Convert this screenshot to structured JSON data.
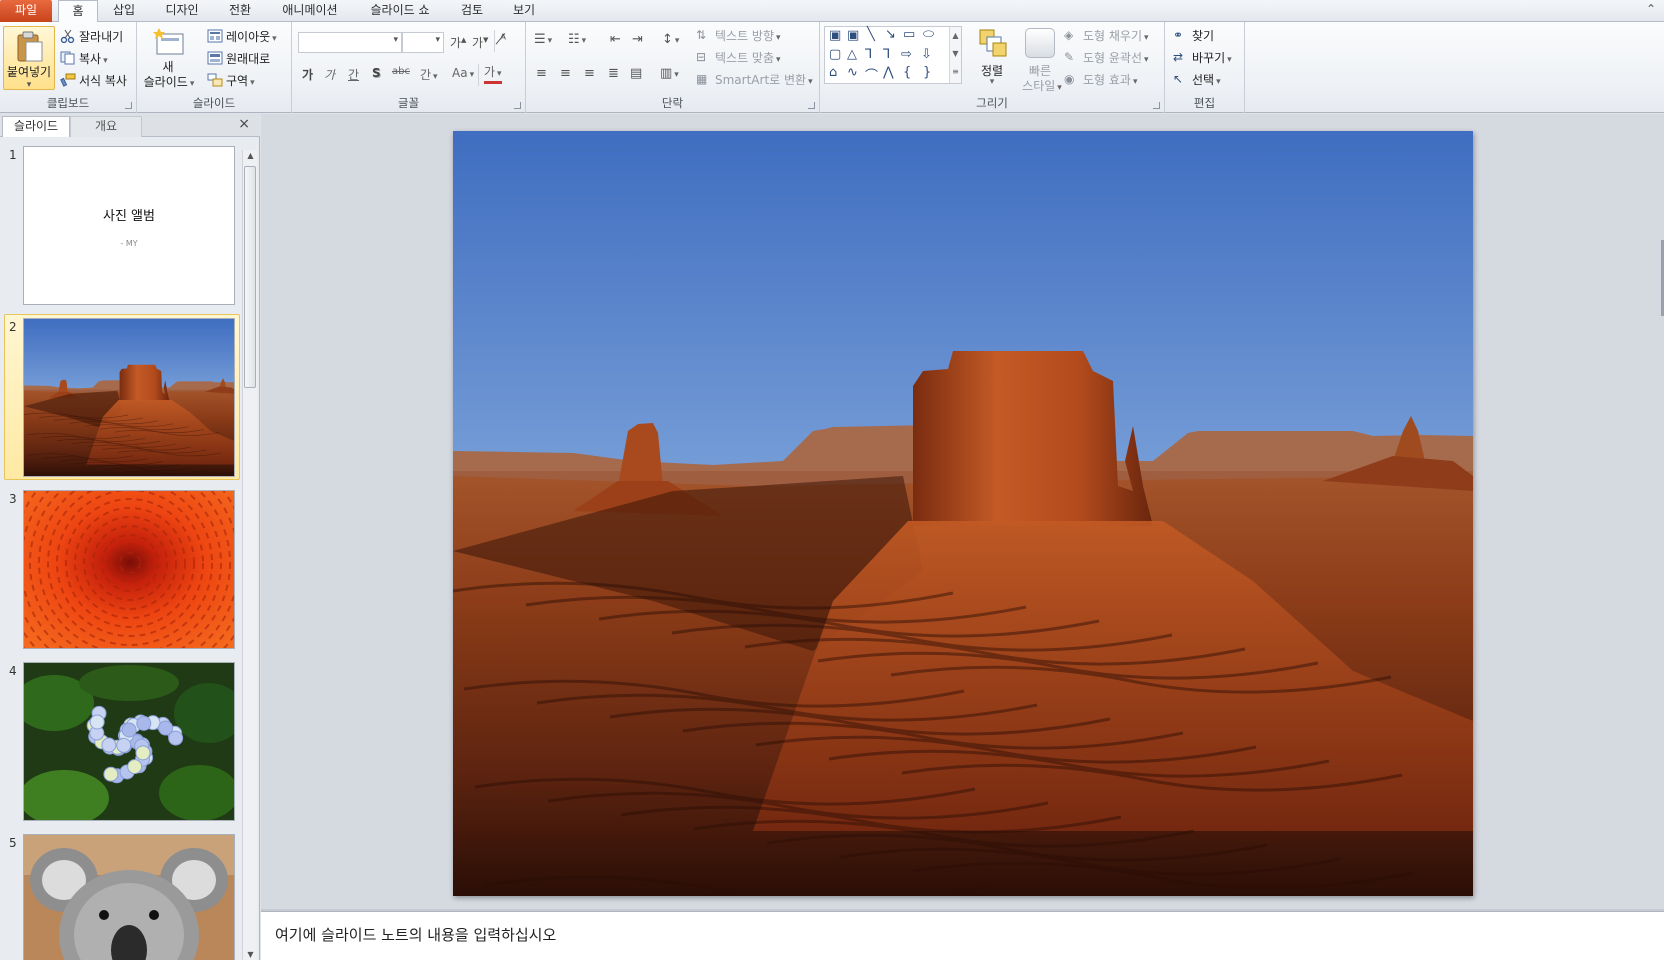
{
  "tabs": [
    {
      "label": "파일",
      "kind": "file"
    },
    {
      "label": "홈",
      "kind": "active"
    },
    {
      "label": "삽입",
      "kind": "normal"
    },
    {
      "label": "디자인",
      "kind": "normal"
    },
    {
      "label": "전환",
      "kind": "normal"
    },
    {
      "label": "애니메이션",
      "kind": "normal"
    },
    {
      "label": "슬라이드 쇼",
      "kind": "normal"
    },
    {
      "label": "검토",
      "kind": "normal"
    },
    {
      "label": "보기",
      "kind": "normal"
    }
  ],
  "ribbon": {
    "clipboard": {
      "label": "클립보드",
      "paste": "붙여넣기",
      "cut": "잘라내기",
      "copy": "복사",
      "format_painter": "서식 복사"
    },
    "slides": {
      "label": "슬라이드",
      "new_slide_1": "새",
      "new_slide_2": "슬라이드",
      "layout": "레이아웃",
      "reset": "원래대로",
      "section": "구역"
    },
    "font": {
      "label": "글꼴",
      "bold": "가",
      "italic": "가",
      "underline": "간",
      "shadow": "S",
      "strike": "abc",
      "spacing": "간",
      "case": "Aa",
      "color": "가"
    },
    "paragraph": {
      "label": "단락",
      "text_direction": "텍스트 방향",
      "align_text": "텍스트 맞춤",
      "smartart": "SmartArt로 변환"
    },
    "drawing": {
      "label": "그리기",
      "arrange": "정렬",
      "quick_styles_1": "빠른",
      "quick_styles_2": "스타일",
      "shape_fill": "도형 채우기",
      "shape_outline": "도형 윤곽선",
      "shape_effects": "도형 효과"
    },
    "editing": {
      "label": "편집",
      "find": "찾기",
      "replace": "바꾸기",
      "select": "선택"
    }
  },
  "panel": {
    "tab_slides": "슬라이드",
    "tab_outline": "개요",
    "close": "×",
    "slides": [
      {
        "num": "1",
        "title": "사진 앨범",
        "subtitle": "- MY"
      },
      {
        "num": "2"
      },
      {
        "num": "3"
      },
      {
        "num": "4"
      },
      {
        "num": "5"
      }
    ]
  },
  "notes": {
    "placeholder": "여기에 슬라이드 노트의 내용을 입력하십시오"
  },
  "colors": {
    "file_tab": "#d5562b",
    "selection": "#ffe9a3",
    "accent": "#2b579a"
  }
}
